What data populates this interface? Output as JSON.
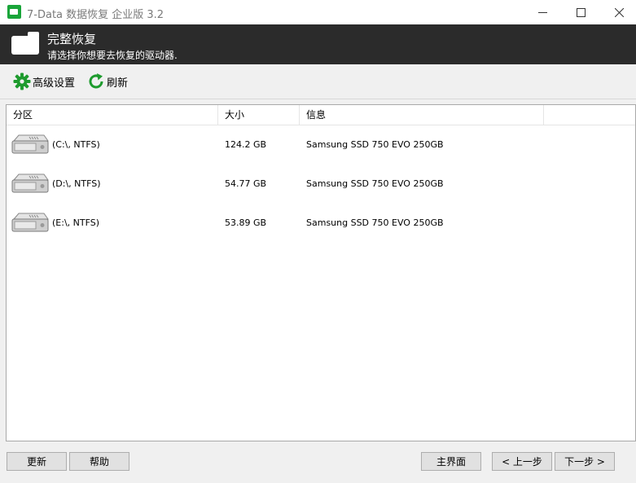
{
  "window": {
    "title": "7-Data 数据恢复 企业版 3.2"
  },
  "header": {
    "title": "完整恢复",
    "subtitle": "请选择你想要去恢复的驱动器."
  },
  "toolbar": {
    "settings_label": "高级设置",
    "refresh_label": "刷新"
  },
  "table": {
    "columns": [
      "分区",
      "大小",
      "信息",
      ""
    ],
    "rows": [
      {
        "name": "(C:\\, NTFS)",
        "size": "124.2 GB",
        "info": "Samsung SSD 750 EVO 250GB"
      },
      {
        "name": "(D:\\, NTFS)",
        "size": "54.77 GB",
        "info": "Samsung SSD 750 EVO 250GB"
      },
      {
        "name": "(E:\\, NTFS)",
        "size": "53.89 GB",
        "info": "Samsung SSD 750 EVO 250GB"
      }
    ]
  },
  "buttons": {
    "update": "更新",
    "help": "帮助",
    "main": "主界面",
    "prev": "< 上一步",
    "next": "下一步 >"
  },
  "colors": {
    "header_bg": "#2b2b2b",
    "icon_green": "#1e9b2e",
    "app_icon": "#1aa53a"
  },
  "icons": {
    "app": "app-icon",
    "header": "folder-icon",
    "settings": "gear-icon",
    "refresh": "refresh-icon",
    "drive": "hard-drive-icon"
  }
}
